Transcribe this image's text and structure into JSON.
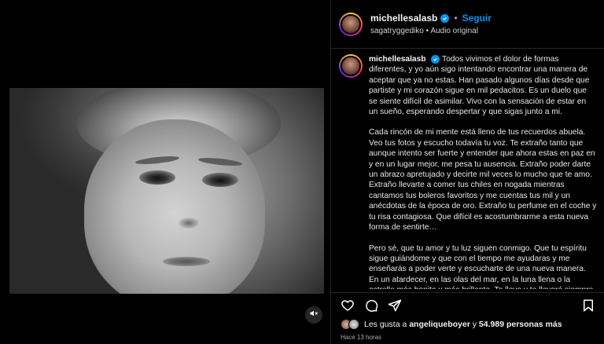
{
  "post": {
    "username": "michellesalasb",
    "follow_label": "Seguir",
    "separator": "•",
    "audio_line": "sagatryggediko • Audio original"
  },
  "caption": {
    "username": "michellesalasb",
    "paragraphs": [
      "Todos vivimos el dolor de formas diferentes, y yo aún sigo intentando encontrar una manera de aceptar que ya no estas. Han pasado algunos días desde que partiste y mi corazón sigue en mil pedacitos. Es un duelo que se siente difícil de asimilar. Vivo con la sensación de estar en un sueño, esperando despertar y que sigas junto a mi.",
      "Cada rincón de mi mente está lleno de tus recuerdos abuela. Veo tus fotos y escucho todavía tu voz. Te extraño tanto que aunque intento ser fuerte y entender que ahora estas en paz en y en un lugar mejor, me pesa tu ausencia. Extraño poder darte un abrazo apretujado y decirte mil veces lo mucho que te amo. Extraño llevarte a comer tus chiles en nogada mientras cantamos tus boleros favoritos y me cuentas tus mil y un anécdotas de la época de oro. Extraño tu perfume en el coche y tu risa contagiosa. Que difícil es acostumbrarme a esta nueva forma de sentirte…",
      "Pero sé, que tu amor y tu luz siguen conmigo. Que tu espíritu sigue guiándome y que con el tiempo me ayudaras y me enseñarás a poder verte y escucharte de una nueva manera. En un atardecer, en las olas del mar, en la luna llena o la estrella más bonita y más brillante. Te llevo y te llevaré siempre en el corazón, eres mi mas grade tesoro. Gracias por todo lo que me diste, por"
    ]
  },
  "engagement": {
    "likes_prefix": "Les gusta a",
    "liker": "angeliqueboyer",
    "likes_middle": "y",
    "likes_count": "54.989 personas más",
    "timestamp": "Hace 13 horas"
  },
  "icons": {
    "like": "heart-icon",
    "comment": "comment-icon",
    "share": "send-icon",
    "save": "bookmark-icon",
    "mute": "speaker-muted-icon"
  },
  "colors": {
    "accent": "#0095f6",
    "background": "#000000",
    "divider": "#262626"
  }
}
